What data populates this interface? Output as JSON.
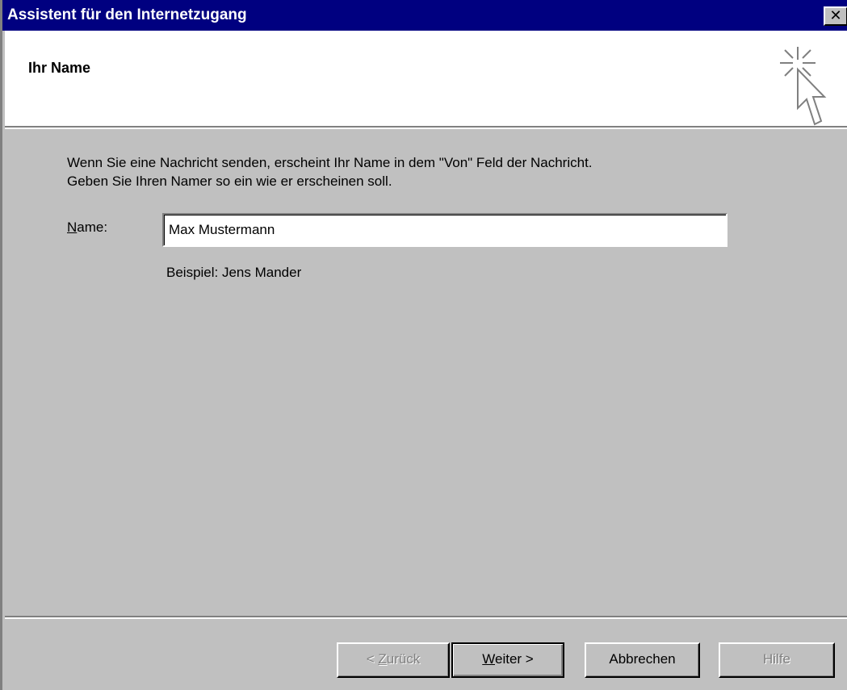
{
  "window": {
    "title": "Assistent für den Internetzugang",
    "close_label": "✕"
  },
  "header": {
    "title": "Ihr Name",
    "icon": "wizard-cursor-icon"
  },
  "content": {
    "intro_line1": "Wenn Sie eine Nachricht senden, erscheint Ihr Name in dem \"Von\" Feld der Nachricht.",
    "intro_line2": "Geben Sie Ihren Namer so ein wie er erscheinen soll.",
    "name_label_accel": "N",
    "name_label_rest": "ame:",
    "name_value": "Max Mustermann",
    "example": "Beispiel: Jens Mander"
  },
  "buttons": {
    "back_prefix": "< ",
    "back_accel": "Z",
    "back_rest": "urück",
    "next_accel": "W",
    "next_rest": "eiter >",
    "cancel": "Abbrechen",
    "help": "Hilfe"
  },
  "colors": {
    "titlebar": "#000080",
    "face": "#c0c0c0",
    "header_bg": "#ffffff",
    "disabled_text": "#808080"
  }
}
